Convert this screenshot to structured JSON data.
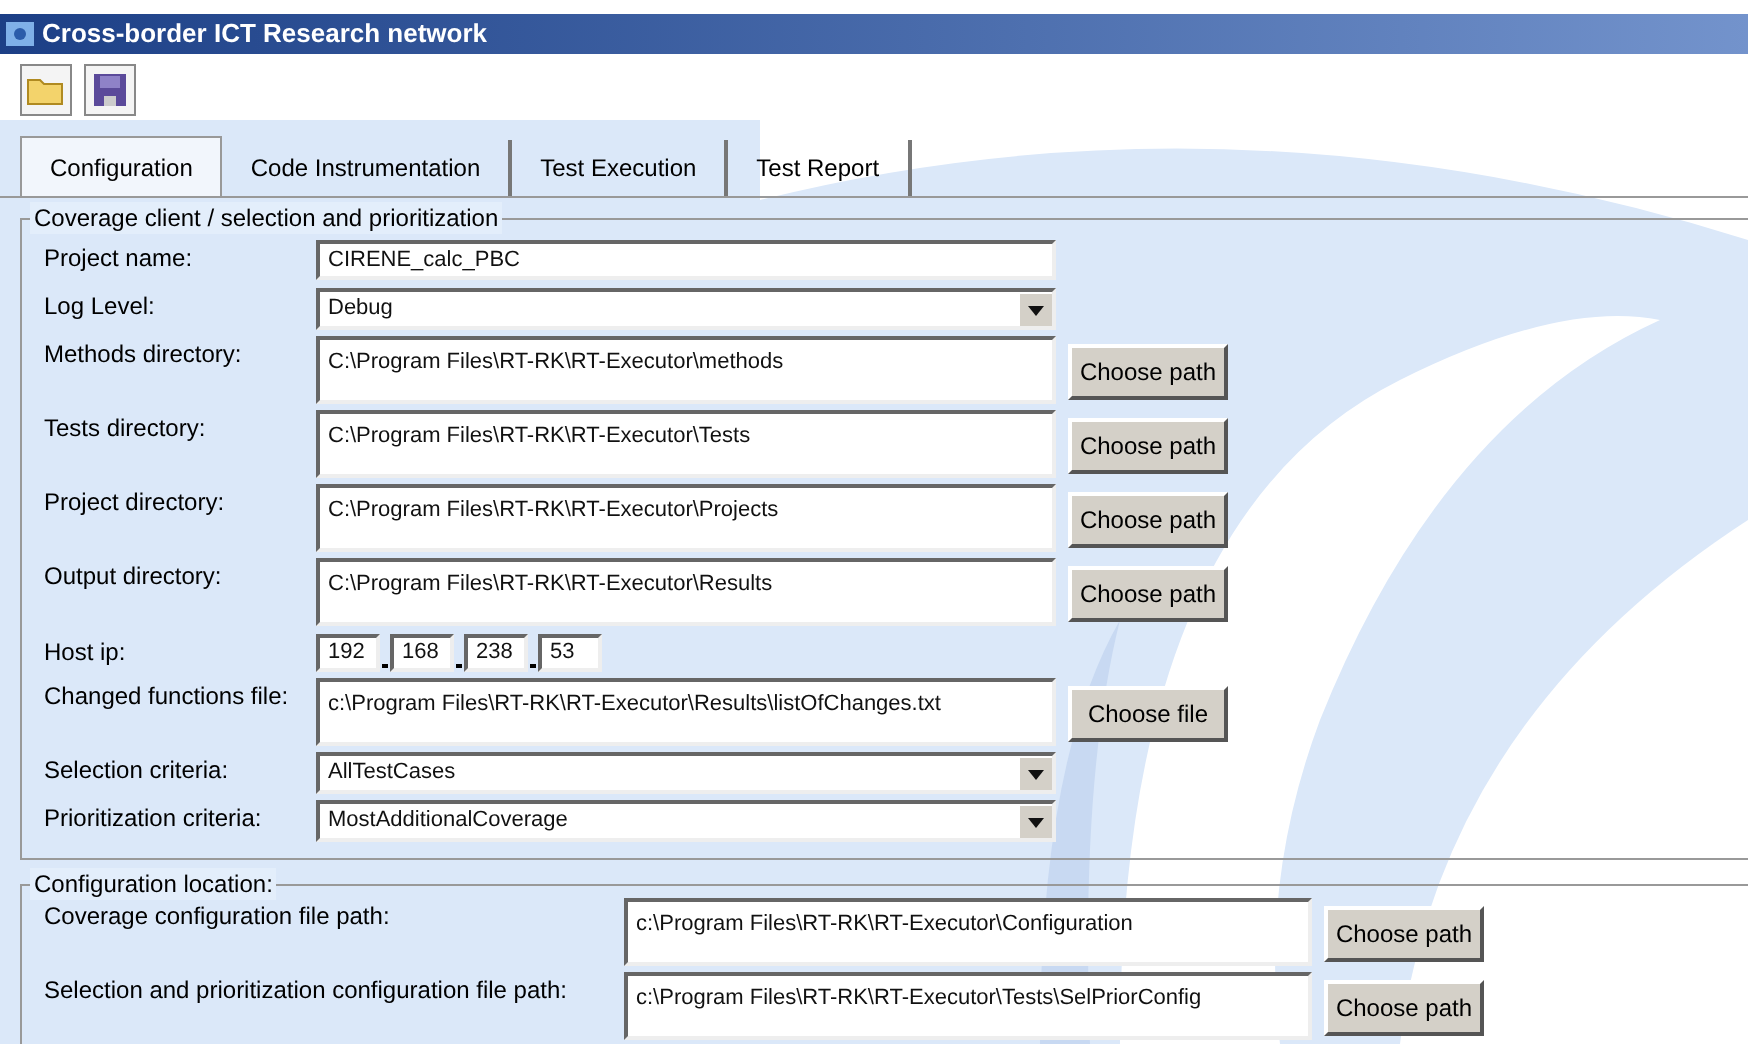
{
  "window": {
    "title": "Cross-border ICT Research network"
  },
  "toolbar": [
    {
      "kind": "open"
    },
    {
      "kind": "save"
    }
  ],
  "tabs": [
    {
      "label": "Configuration",
      "selected": true
    },
    {
      "label": "Code Instrumentation",
      "selected": false
    },
    {
      "label": "Test Execution",
      "selected": false
    },
    {
      "label": "Test Report",
      "selected": false
    }
  ],
  "coverage_section": {
    "title": "Coverage client / selection and prioritization",
    "fields": [
      {
        "kind": "text",
        "label": "Project name:",
        "value": "CIRENE_calc_PBC"
      },
      {
        "kind": "dropdown",
        "label": "Log Level:",
        "value": "Debug"
      },
      {
        "kind": "path",
        "label": "Methods directory:",
        "value": "C:\\Program Files\\RT-RK\\RT-Executor\\methods",
        "button": "Choose path"
      },
      {
        "kind": "path",
        "label": "Tests directory:",
        "value": "C:\\Program Files\\RT-RK\\RT-Executor\\Tests",
        "button": "Choose path"
      },
      {
        "kind": "path",
        "label": "Project directory:",
        "value": "C:\\Program Files\\RT-RK\\RT-Executor\\Projects",
        "button": "Choose path"
      },
      {
        "kind": "path",
        "label": "Output directory:",
        "value": "C:\\Program Files\\RT-RK\\RT-Executor\\Results",
        "button": "Choose path"
      },
      {
        "kind": "ip",
        "label": "Host ip:",
        "octets": [
          "192",
          "168",
          "238",
          "53"
        ]
      },
      {
        "kind": "path",
        "label": "Changed functions file:",
        "value": "c:\\Program Files\\RT-RK\\RT-Executor\\Results\\listOfChanges.txt",
        "button": "Choose file"
      },
      {
        "kind": "dropdown",
        "label": "Selection criteria:",
        "value": "AllTestCases"
      },
      {
        "kind": "dropdown",
        "label": "Prioritization criteria:",
        "value": "MostAdditionalCoverage"
      }
    ]
  },
  "location_section": {
    "title": "Configuration location:",
    "fields": [
      {
        "label": "Coverage configuration file path:",
        "value": "c:\\Program Files\\RT-RK\\RT-Executor\\Configuration",
        "button": "Choose path"
      },
      {
        "label": "Selection and prioritization configuration file path:",
        "value": "c:\\Program Files\\RT-RK\\RT-Executor\\Tests\\SelPriorConfig",
        "button": "Choose path"
      }
    ]
  }
}
